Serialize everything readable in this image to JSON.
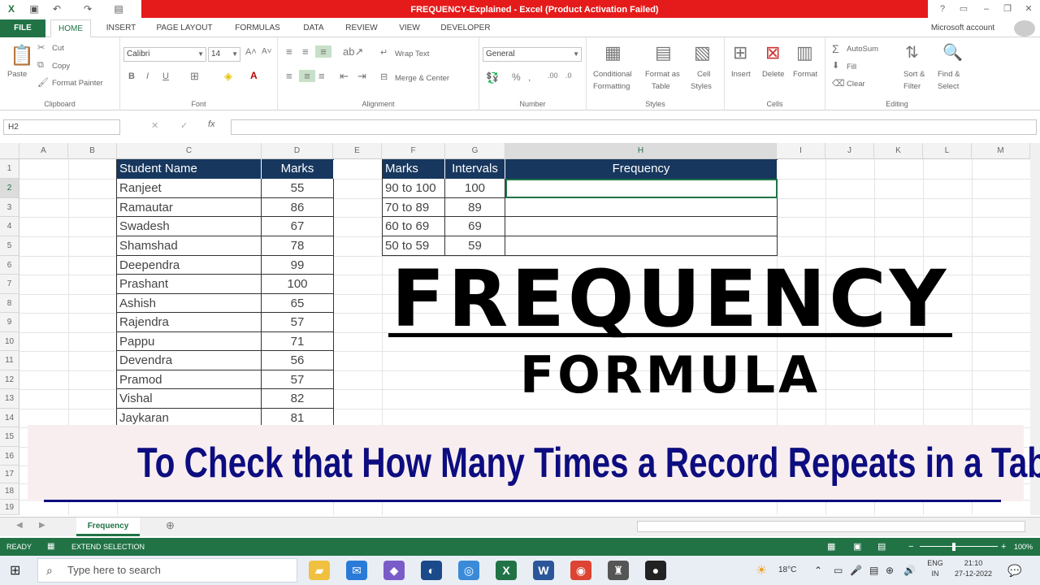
{
  "window": {
    "title": "FREQUENCY-Explained - Excel (Product Activation Failed)",
    "account": "Microsoft account"
  },
  "ribbon": {
    "tabs": [
      "FILE",
      "HOME",
      "INSERT",
      "PAGE LAYOUT",
      "FORMULAS",
      "DATA",
      "REVIEW",
      "VIEW",
      "DEVELOPER"
    ],
    "clipboard": {
      "paste": "Paste",
      "cut": "Cut",
      "copy": "Copy",
      "format_painter": "Format Painter",
      "label": "Clipboard"
    },
    "font": {
      "name": "Calibri",
      "size": "14",
      "label": "Font"
    },
    "alignment": {
      "wrap": "Wrap Text",
      "merge": "Merge & Center",
      "label": "Alignment"
    },
    "number": {
      "format": "General",
      "label": "Number"
    },
    "styles": {
      "conditional": "Conditional",
      "conditional2": "Formatting",
      "format_table": "Format as",
      "format_table2": "Table",
      "cell_styles": "Cell",
      "cell_styles2": "Styles",
      "label": "Styles"
    },
    "cells": {
      "insert": "Insert",
      "delete": "Delete",
      "format": "Format",
      "label": "Cells"
    },
    "editing": {
      "autosum": "AutoSum",
      "fill": "Fill",
      "clear": "Clear",
      "sort": "Sort &",
      "sort2": "Filter",
      "find": "Find &",
      "find2": "Select",
      "label": "Editing"
    }
  },
  "formula_bar": {
    "name_box": "H2",
    "content": ""
  },
  "grid": {
    "columns": [
      "A",
      "B",
      "C",
      "D",
      "E",
      "F",
      "G",
      "H",
      "I",
      "J",
      "K",
      "L",
      "M"
    ],
    "rows": [
      "1",
      "2",
      "3",
      "4",
      "5",
      "6",
      "7",
      "8",
      "9",
      "10",
      "11",
      "12",
      "13",
      "14",
      "15",
      "16",
      "17",
      "18",
      "19"
    ]
  },
  "students": {
    "headers": [
      "Student Name",
      "Marks"
    ],
    "rows": [
      [
        "Ranjeet",
        "55"
      ],
      [
        "Ramautar",
        "86"
      ],
      [
        "Swadesh",
        "67"
      ],
      [
        "Shamshad",
        "78"
      ],
      [
        "Deependra",
        "99"
      ],
      [
        "Prashant",
        "100"
      ],
      [
        "Ashish",
        "65"
      ],
      [
        "Rajendra",
        "57"
      ],
      [
        "Pappu",
        "71"
      ],
      [
        "Devendra",
        "56"
      ],
      [
        "Pramod",
        "57"
      ],
      [
        "Vishal",
        "82"
      ],
      [
        "Jaykaran",
        "81"
      ]
    ]
  },
  "freq_table": {
    "headers": [
      "Marks",
      "Intervals",
      "Frequency"
    ],
    "rows": [
      [
        "90 to 100",
        "100",
        ""
      ],
      [
        "70 to 89",
        "89",
        ""
      ],
      [
        "60 to 69",
        "69",
        ""
      ],
      [
        "50 to 59",
        "59",
        ""
      ]
    ]
  },
  "overlay": {
    "title": "FREQUENCY",
    "subtitle": "FORMULA",
    "banner": "To Check that How Many Times a Record Repeats in a Table"
  },
  "sheet": {
    "tab": "Frequency"
  },
  "status": {
    "ready": "READY",
    "mode": "EXTEND SELECTION",
    "zoom": "100%"
  },
  "taskbar": {
    "search": "Type here to search",
    "temp": "18°C",
    "lang1": "ENG",
    "lang2": "IN",
    "time": "21:10",
    "date": "27-12-2022"
  }
}
